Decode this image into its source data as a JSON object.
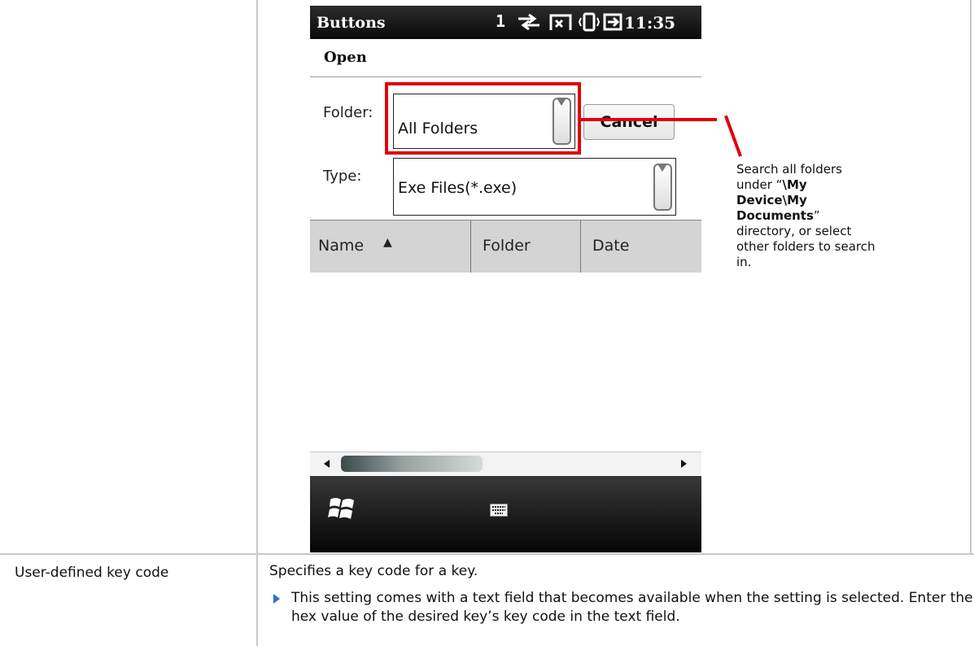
{
  "phone": {
    "statusbar": {
      "title": "Buttons",
      "signal_digit": "1",
      "time": "11:35",
      "icons": [
        "sync-arrows-icon",
        "signal-icon",
        "vibrate-icon",
        "battery-charging-icon"
      ]
    },
    "dialog_title": "Open",
    "folder_label": "Folder:",
    "folder_value": "All Folders",
    "cancel_label": "Cancel",
    "type_label": "Type:",
    "type_value": "Exe Files(*.exe)",
    "columns": [
      "Name",
      "Folder",
      "Date"
    ],
    "sort_indicator": "▲",
    "taskbar_icons": [
      "windows-start-icon",
      "keyboard-icon"
    ]
  },
  "callout": {
    "text_before": "Search all folders under “",
    "path": "\\My Device\\My Documents",
    "text_after": "” directory, or select other folders to search in."
  },
  "row": {
    "setting_name": "User-defined key code",
    "description": "Specifies a key code for a key.",
    "note": "This setting comes with a text field that becomes available when the setting is selected. Enter the hex value of the desired key’s key code in the text field."
  },
  "colors": {
    "highlight": "#e0000a",
    "bullet": "#2f6fd0"
  }
}
